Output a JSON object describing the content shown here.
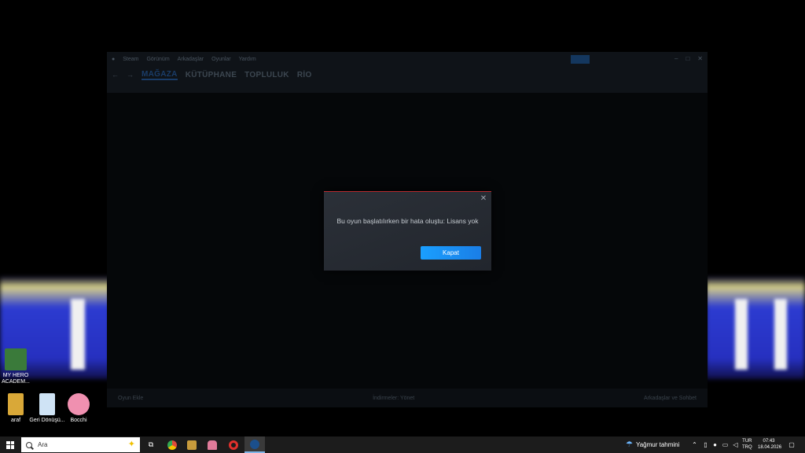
{
  "desktop": {
    "icons": [
      {
        "label": "MY HERO ACADEM...",
        "icon": "mha-game-icon",
        "color": "#3a7a3a"
      },
      {
        "label": "araf",
        "icon": "araf-folder-icon",
        "color": "#d9a838"
      },
      {
        "label": "Geri Dönüşü...",
        "icon": "recycle-bin-icon",
        "color": "#cfe3f5"
      },
      {
        "label": "Bocchi",
        "icon": "bocchi-shortcut-icon",
        "color": "#f090b0"
      }
    ]
  },
  "steam": {
    "menu": [
      "Steam",
      "Görünüm",
      "Arkadaşlar",
      "Oyunlar",
      "Yardım"
    ],
    "nav_tabs": [
      "MAĞAZA",
      "KÜTÜPHANE",
      "TOPLULUK",
      "RİO"
    ],
    "footer": {
      "left": "Oyun Ekle",
      "center": "İndirmeler: Yönet",
      "right": "Arkadaşlar ve Sohbet"
    }
  },
  "dialog": {
    "message": "Bu oyun başlatılırken bir hata oluştu: Lisans yok",
    "ok_label": "Kapat",
    "accent": "#1a9fff",
    "border_accent": "#b5292d"
  },
  "taskbar": {
    "search_placeholder": "Ara",
    "apps": [
      "task-view-icon",
      "chrome-app-icon",
      "league-app-icon",
      "ghost-app-icon",
      "opera-app-icon",
      "steam-app-icon"
    ],
    "weather": "Yağmur tahmini",
    "lang_top": "TUR",
    "lang_bottom": "TRQ",
    "time": "07:43",
    "date": "18.04.2026"
  }
}
